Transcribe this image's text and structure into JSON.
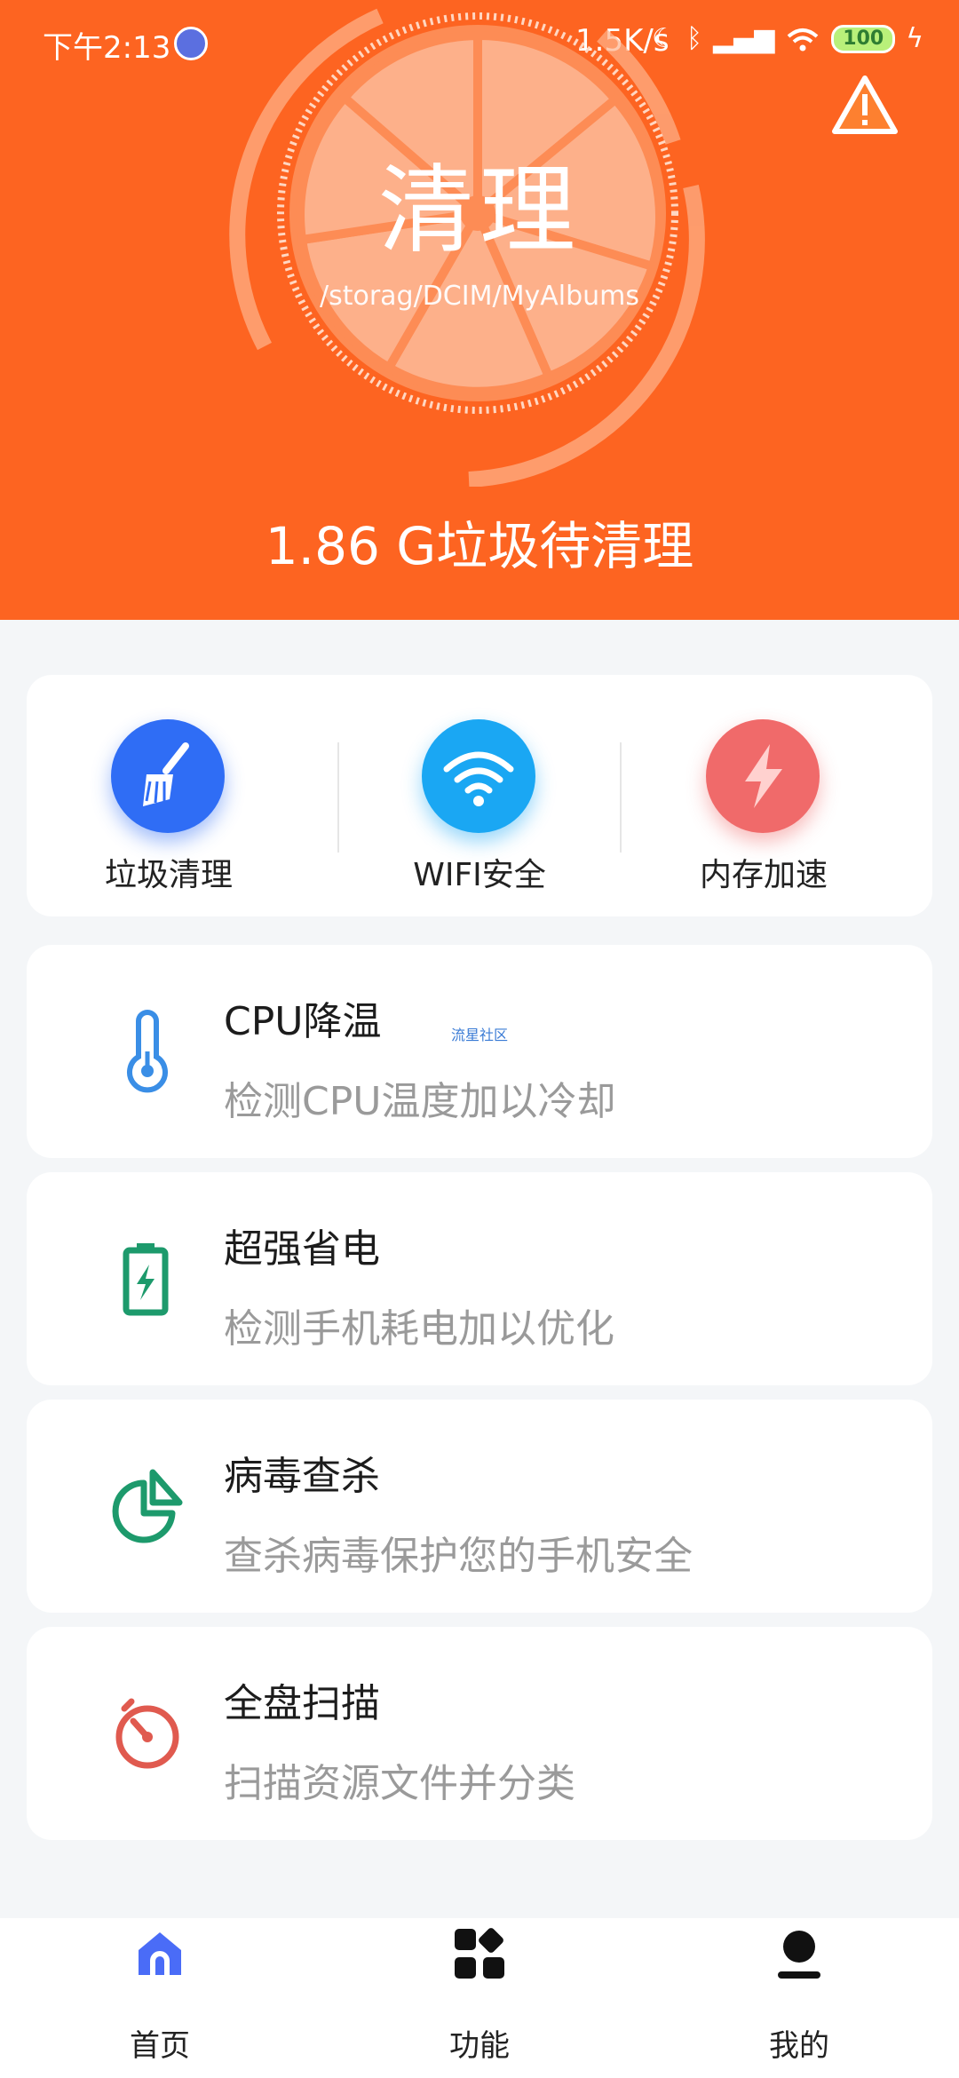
{
  "status_bar": {
    "time": "下午2:13",
    "net_speed": "1.5K/s",
    "battery": "100"
  },
  "header": {
    "title": "清理",
    "path": "/storag/DCIM/MyAlbums",
    "junk_text": "1.86 G垃圾待清理"
  },
  "quick_actions": [
    {
      "label": "垃圾清理",
      "icon": "broom-icon",
      "color": "#2f6df5"
    },
    {
      "label": "WIFI安全",
      "icon": "wifi-icon",
      "color": "#1aa7f3"
    },
    {
      "label": "内存加速",
      "icon": "lightning-icon",
      "color": "#f06a6a"
    }
  ],
  "features": [
    {
      "title": "CPU降温",
      "desc": "检测CPU温度加以冷却",
      "icon": "thermometer-icon",
      "color": "#3a8ee6"
    },
    {
      "title": "超强省电",
      "desc": "检测手机耗电加以优化",
      "icon": "battery-icon",
      "color": "#1d9a6c"
    },
    {
      "title": "病毒查杀",
      "desc": "查杀病毒保护您的手机安全",
      "icon": "pie-chart-icon",
      "color": "#1d9a6c"
    },
    {
      "title": "全盘扫描",
      "desc": "扫描资源文件并分类",
      "icon": "timer-icon",
      "color": "#e05a4f"
    }
  ],
  "watermark": "流星社区",
  "bottom_nav": [
    {
      "label": "首页",
      "icon": "home-icon"
    },
    {
      "label": "功能",
      "icon": "grid-icon"
    },
    {
      "label": "我的",
      "icon": "user-icon"
    }
  ],
  "colors": {
    "brand": "#fd6421",
    "active_tab": "#4a6cf7"
  }
}
